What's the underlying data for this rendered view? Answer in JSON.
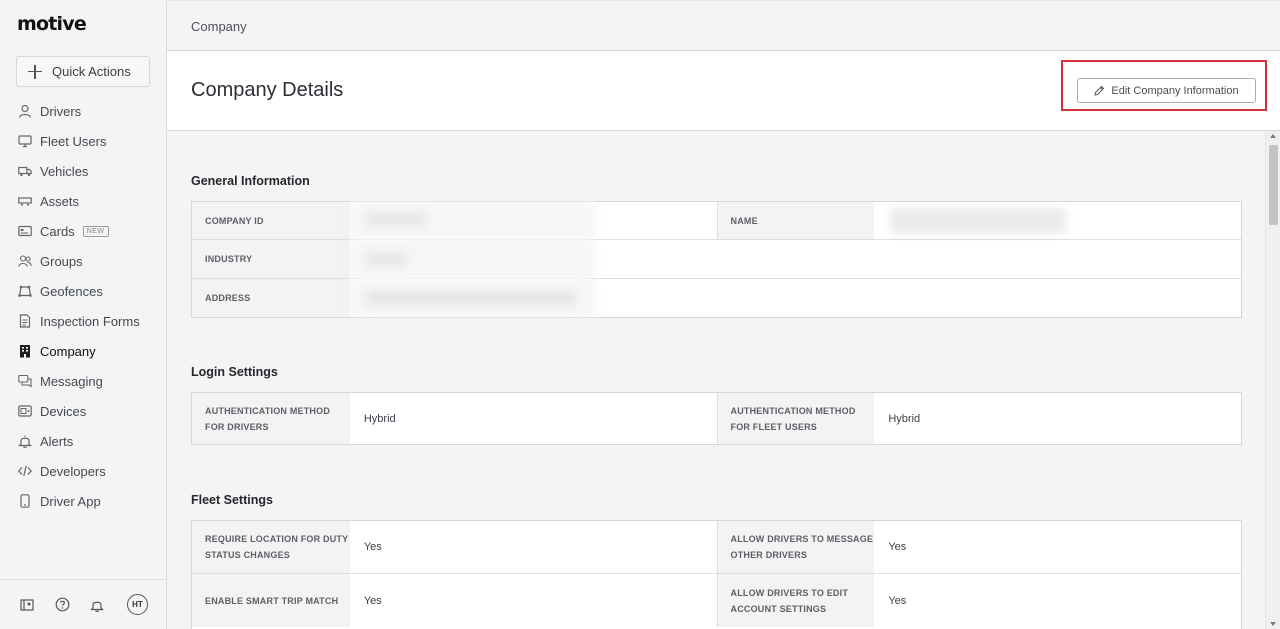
{
  "app": {
    "logo": "motive",
    "quick_actions_label": "Quick Actions"
  },
  "sidebar": {
    "items": [
      {
        "label": "Drivers",
        "icon": "person-icon"
      },
      {
        "label": "Fleet Users",
        "icon": "monitor-icon"
      },
      {
        "label": "Vehicles",
        "icon": "truck-icon"
      },
      {
        "label": "Assets",
        "icon": "trailer-icon"
      },
      {
        "label": "Cards",
        "icon": "card-icon",
        "badge": "NEW"
      },
      {
        "label": "Groups",
        "icon": "group-icon"
      },
      {
        "label": "Geofences",
        "icon": "geofence-icon"
      },
      {
        "label": "Inspection Forms",
        "icon": "document-icon"
      },
      {
        "label": "Company",
        "icon": "building-icon",
        "active": true
      },
      {
        "label": "Messaging",
        "icon": "chat-icon"
      },
      {
        "label": "Devices",
        "icon": "device-icon"
      },
      {
        "label": "Alerts",
        "icon": "bell-icon"
      },
      {
        "label": "Developers",
        "icon": "code-icon"
      },
      {
        "label": "Driver App",
        "icon": "phone-icon"
      }
    ],
    "footer": {
      "avatar_initials": "HT"
    }
  },
  "topbar": {
    "breadcrumb": "Company"
  },
  "header": {
    "title": "Company Details",
    "edit_button_label": "Edit Company Information"
  },
  "general_information": {
    "title": "General Information",
    "labels": {
      "company_id": "COMPANY ID",
      "name": "NAME",
      "industry": "INDUSTRY",
      "address": "ADDRESS"
    }
  },
  "login_settings": {
    "title": "Login Settings",
    "rows": [
      {
        "label_a": "AUTHENTICATION METHOD FOR DRIVERS",
        "value_a": "Hybrid",
        "label_b": "AUTHENTICATION METHOD FOR FLEET USERS",
        "value_b": "Hybrid"
      }
    ]
  },
  "fleet_settings": {
    "title": "Fleet Settings",
    "rows": [
      {
        "label_a": "REQUIRE LOCATION FOR DUTY STATUS CHANGES",
        "value_a": "Yes",
        "label_b": "ALLOW DRIVERS TO MESSAGE OTHER DRIVERS",
        "value_b": "Yes"
      },
      {
        "label_a": "ENABLE SMART TRIP MATCH",
        "value_a": "Yes",
        "label_b": "ALLOW DRIVERS TO EDIT ACCOUNT SETTINGS",
        "value_b": "Yes"
      }
    ]
  },
  "colors": {
    "highlight": "#d0313a",
    "sidebar_bg": "#f4f4f5"
  }
}
